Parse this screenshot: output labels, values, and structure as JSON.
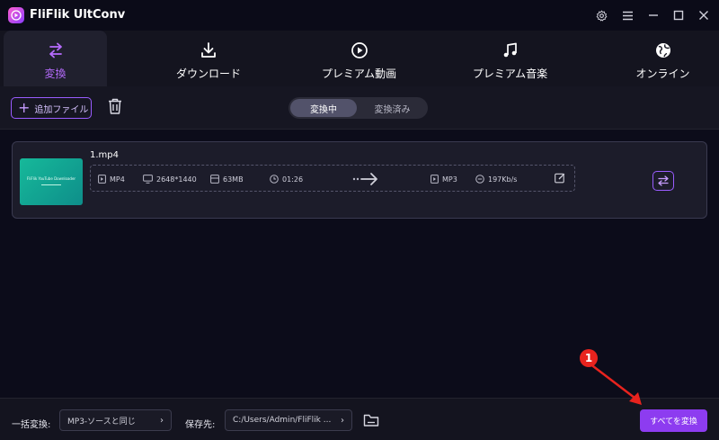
{
  "app": {
    "title": "FliFlik UltConv"
  },
  "nav": {
    "tabs": [
      {
        "label": "変換"
      },
      {
        "label": "ダウンロード"
      },
      {
        "label": "プレミアム動画"
      },
      {
        "label": "プレミアム音楽"
      },
      {
        "label": "オンライン"
      }
    ]
  },
  "toolbar": {
    "add_label": "追加ファイル",
    "segment": {
      "converting": "変換中",
      "converted": "変換済み"
    }
  },
  "file": {
    "name": "1.mp4",
    "thumbnail_text": "FliFlik YouTube Downloader",
    "source": {
      "format": "MP4",
      "resolution": "2648*1440",
      "size": "63MB",
      "duration": "01:26"
    },
    "target": {
      "format": "MP3",
      "bitrate": "197Kb/s"
    }
  },
  "footer": {
    "batch_label": "一括変換:",
    "batch_value": "MP3-ソースと同じ",
    "save_label": "保存先:",
    "save_path": "C:/Users/Admin/FliFlik ...",
    "convert_all": "すべてを変換"
  },
  "annotation": {
    "step": "1"
  },
  "colors": {
    "accent": "#8d3cf0",
    "active_tab_text": "#b76cff",
    "annotation": "#e8231e"
  }
}
